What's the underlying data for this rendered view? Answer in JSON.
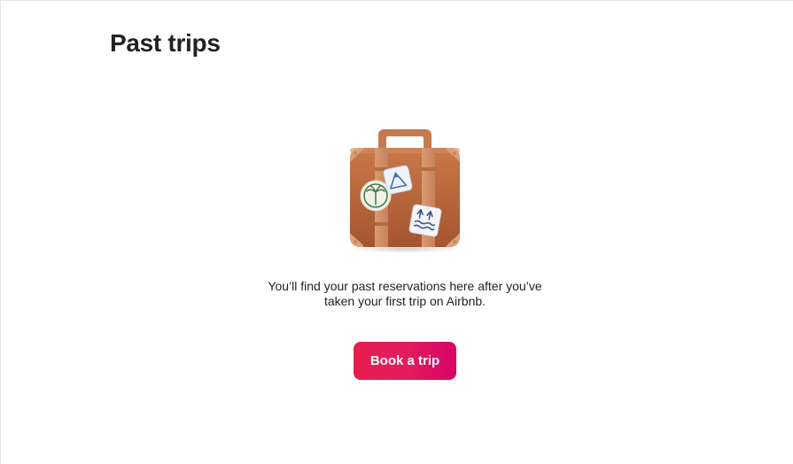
{
  "page": {
    "title": "Past trips"
  },
  "empty_state": {
    "illustration": "suitcase-with-stickers",
    "message": "You’ll find your past reservations here after you’ve taken your first trip on Airbnb.",
    "button_label": "Book a trip"
  },
  "colors": {
    "brand_gradient_start": "#e61e4d",
    "brand_gradient_end": "#d70466",
    "text": "#222222"
  }
}
